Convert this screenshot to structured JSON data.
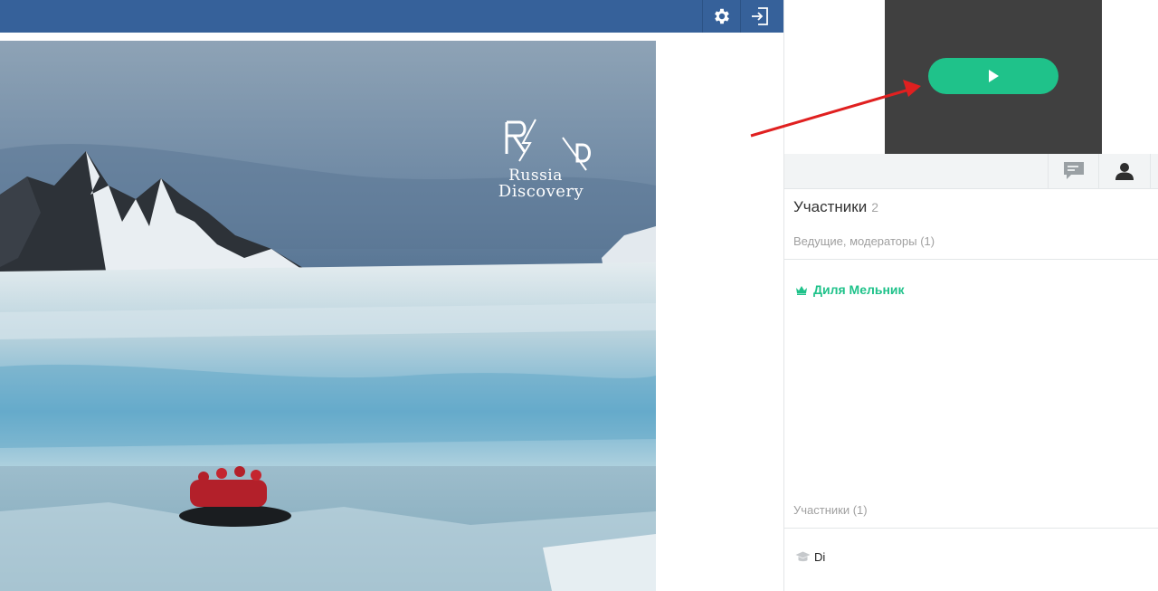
{
  "toolbar": {
    "settings_icon": "gear-icon",
    "exit_icon": "exit-icon"
  },
  "slide": {
    "logo_line1": "Russia",
    "logo_line2": "Discovery"
  },
  "video": {
    "play_icon": "play-icon",
    "accent": "#1fc28a"
  },
  "panel": {
    "tabs": [
      {
        "icon": "chat-icon"
      },
      {
        "icon": "user-icon"
      }
    ],
    "title": "Участники",
    "count": "2",
    "hosts_label": "Ведущие, модераторы (1)",
    "host_name": "Диля Мельник",
    "participants_label": "Участники (1)",
    "participant_name": "Di"
  },
  "colors": {
    "topbar": "#36619a",
    "green": "#1fc28a",
    "arrow": "#e02020"
  }
}
